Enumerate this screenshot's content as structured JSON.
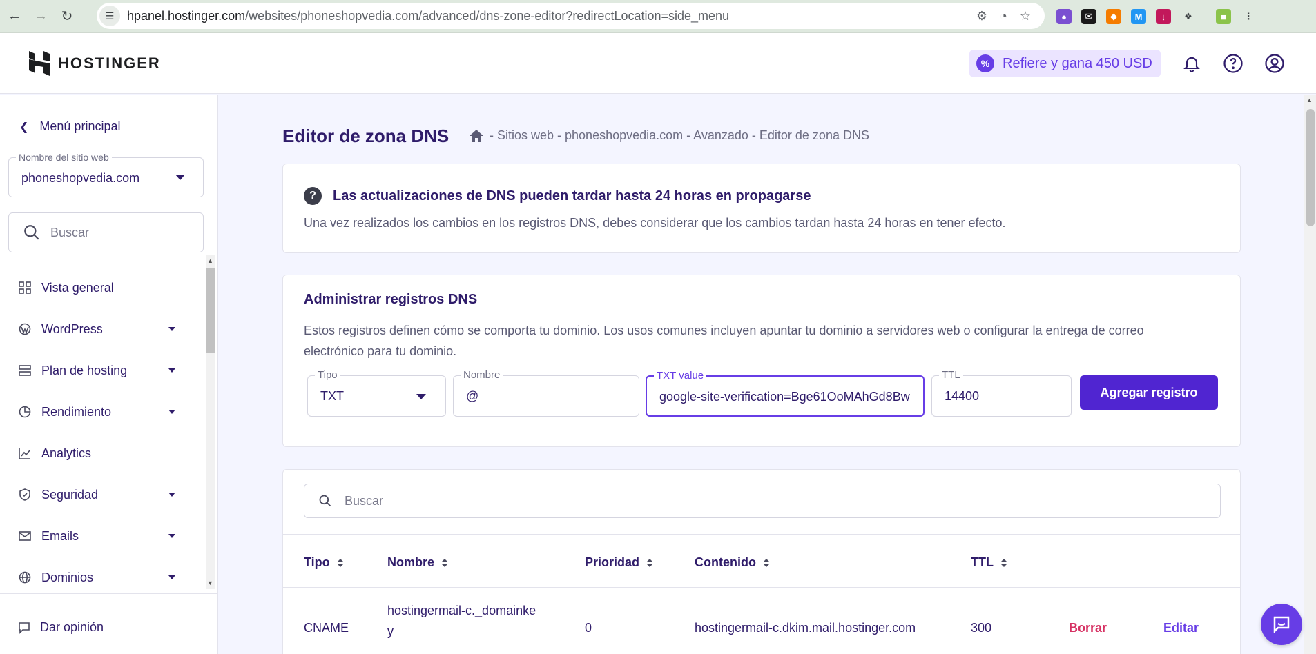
{
  "browser": {
    "url_host": "hpanel.hostinger.com",
    "url_path": "/websites/phoneshopvedia.com/advanced/dns-zone-editor?redirectLocation=side_menu"
  },
  "header": {
    "logo_text": "HOSTINGER",
    "refer_label": "Refiere y gana 450 USD",
    "accent_color": "#673de6"
  },
  "sidebar": {
    "back_label": "Menú principal",
    "site_select": {
      "label": "Nombre del sitio web",
      "value": "phoneshopvedia.com"
    },
    "search_placeholder": "Buscar",
    "items": [
      {
        "label": "Vista general",
        "icon": "grid-icon",
        "has_dropdown": false
      },
      {
        "label": "WordPress",
        "icon": "wordpress-icon",
        "has_dropdown": true
      },
      {
        "label": "Plan de hosting",
        "icon": "server-icon",
        "has_dropdown": true
      },
      {
        "label": "Rendimiento",
        "icon": "pie-chart-icon",
        "has_dropdown": true
      },
      {
        "label": "Analytics",
        "icon": "trend-icon",
        "has_dropdown": false
      },
      {
        "label": "Seguridad",
        "icon": "shield-icon",
        "has_dropdown": true
      },
      {
        "label": "Emails",
        "icon": "mail-icon",
        "has_dropdown": true
      },
      {
        "label": "Dominios",
        "icon": "globe-icon",
        "has_dropdown": true
      }
    ],
    "feedback_label": "Dar opinión"
  },
  "main": {
    "title": "Editor de zona DNS",
    "breadcrumb": "- Sitios web - phoneshopvedia.com - Avanzado - Editor de zona DNS",
    "notice": {
      "heading": "Las actualizaciones de DNS pueden tardar hasta 24 horas en propagarse",
      "body": "Una vez realizados los cambios en los registros DNS, debes considerar que los cambios tardan hasta 24 horas en tener efecto."
    },
    "manage": {
      "heading": "Administrar registros DNS",
      "body": "Estos registros definen cómo se comporta tu dominio. Los usos comunes incluyen apuntar tu dominio a servidores web o configurar la entrega de correo electrónico para tu dominio.",
      "type": {
        "label": "Tipo",
        "value": "TXT"
      },
      "name": {
        "label": "Nombre",
        "value": "@"
      },
      "txt": {
        "label": "TXT value",
        "value": "google-site-verification=Bge61OoMAhGd8Bw"
      },
      "ttl": {
        "label": "TTL",
        "value": "14400"
      },
      "add_button": "Agregar registro"
    },
    "table": {
      "search_placeholder": "Buscar",
      "headers": [
        "Tipo",
        "Nombre",
        "Prioridad",
        "Contenido",
        "TTL"
      ],
      "rows": [
        {
          "tipo": "CNAME",
          "nombre_line1": "hostingermail-c._domainke",
          "nombre_line2": "y",
          "prioridad": "0",
          "contenido": "hostingermail-c.dkim.mail.hostinger.com",
          "ttl": "300",
          "delete": "Borrar",
          "edit": "Editar"
        }
      ]
    }
  }
}
